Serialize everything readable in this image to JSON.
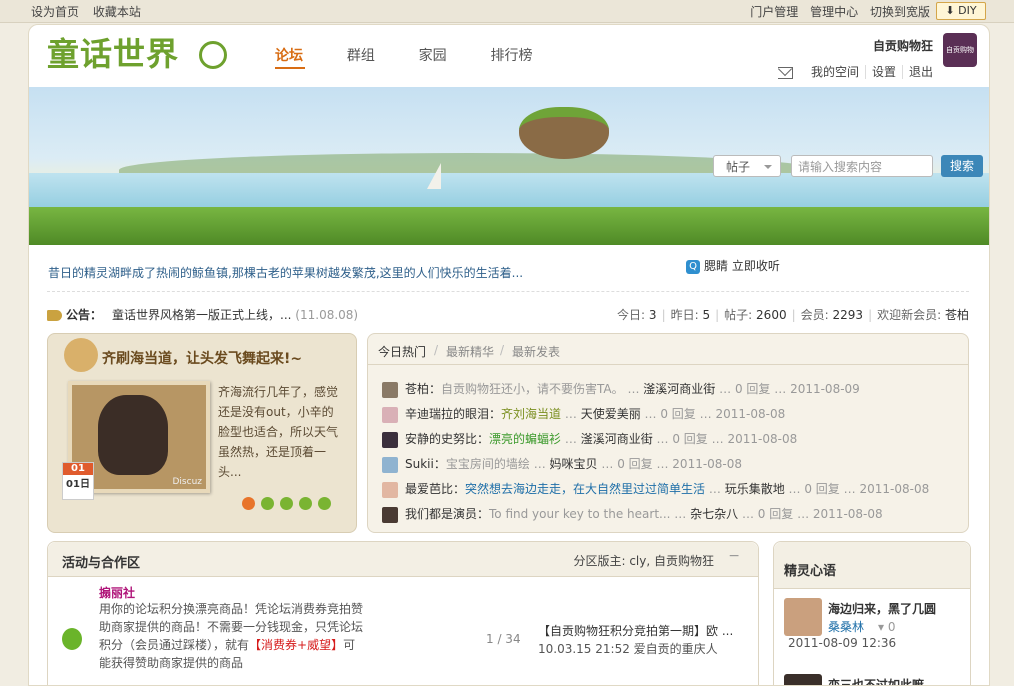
{
  "topbar": {
    "left_links": [
      "设为首页",
      "收藏本站"
    ],
    "right_links": [
      "门户管理",
      "管理中心",
      "切换到宽版"
    ],
    "diy_label": "DIY"
  },
  "logo": {
    "text": "童话世界"
  },
  "nav": {
    "items": [
      "论坛",
      "群组",
      "家园",
      "排行榜"
    ],
    "active_index": 0
  },
  "user": {
    "name": "自贡购物狂",
    "links": [
      "我的空间",
      "设置",
      "退出"
    ],
    "avatar_text": "自贡购物狂"
  },
  "search": {
    "scope": "帖子",
    "placeholder": "请输入搜索内容",
    "button": "搜索"
  },
  "intro": {
    "text": "昔日的精灵湖畔成了热闹的鲸鱼镇,那棵古老的苹果树越发繁茂,这里的人们快乐的生活着..."
  },
  "qq": {
    "label": "腮睛 立即收听"
  },
  "notice": {
    "label": "公告：",
    "text": "童话世界风格第一版正式上线，...",
    "date": "(11.08.08)"
  },
  "stats": {
    "today_label": "今日:",
    "today": "3",
    "yesterday_label": "昨日:",
    "yesterday": "5",
    "posts_label": "帖子:",
    "posts": "2600",
    "members_label": "会员:",
    "members": "2293",
    "welcome_label": "欢迎新会员:",
    "newest": "苍柏"
  },
  "promo": {
    "title": "齐刷海当道，让头发飞舞起来!~",
    "body": "齐海流行几年了，感觉还是没有out，小辛的脸型也适合，所以天气虽然热，还是顶着一头...",
    "calendar_top": "01",
    "calendar_day": "01日",
    "photo_caption": "Discuz"
  },
  "hot": {
    "tabs": [
      "今日热门",
      "最新精华",
      "最新发表"
    ],
    "items": [
      {
        "author": "苍柏：",
        "title": "自贡购物狂还小，请不要伤害TA。",
        "forum": "滏溪河商业街",
        "replies": "0 回复",
        "date": "2011-08-09"
      },
      {
        "author": "辛迪瑞拉的眼泪：",
        "title": "齐刘海当道",
        "forum": "天使爱美丽",
        "replies": "0 回复",
        "date": "2011-08-08"
      },
      {
        "author": "安静的史努比：",
        "title": "漂亮的蝙蝠衫",
        "forum": "滏溪河商业街",
        "replies": "0 回复",
        "date": "2011-08-08"
      },
      {
        "author": "Sukii：",
        "title": "宝宝房间的墙绘",
        "forum": "妈咪宝贝",
        "replies": "0 回复",
        "date": "2011-08-08"
      },
      {
        "author": "最爱芭比：",
        "title": "突然想去海边走走，在大自然里过过简单生活",
        "forum": "玩乐集散地",
        "replies": "0 回复",
        "date": "2011-08-08"
      },
      {
        "author": "我们都是演员：",
        "title": "To find your key to the heart...",
        "forum": "杂七杂八",
        "replies": "0 回复",
        "date": "2011-08-08"
      }
    ]
  },
  "activity": {
    "title": "活动与合作区",
    "moderators": "分区版主: cly, 自贡购物狂",
    "collapse": "−",
    "forum_name": "搧丽社",
    "desc_1": "用你的论坛积分换漂亮商品！凭论坛消费券竞拍赞助商家提供的商品！不需要一分钱现金，只凭论坛积分（会员通过踩楼），就有",
    "desc_red": "【消费券+威望】",
    "desc_2": "可能获得赞助商家提供的商品",
    "count": "1 / 34",
    "last_title": "【自贡购物狂积分竞拍第一期】欧 ...",
    "last_meta": "10.03.15 21:52 爱自贡的重庆人"
  },
  "sidebar": {
    "title": "精灵心语",
    "entry1_title": "海边归来，黑了几圆",
    "entry1_user": "桑桑林",
    "entry1_comments": "0",
    "entry1_date": "2011-08-09 12:36",
    "entry2_title": "恋三也不过如此嘛"
  }
}
